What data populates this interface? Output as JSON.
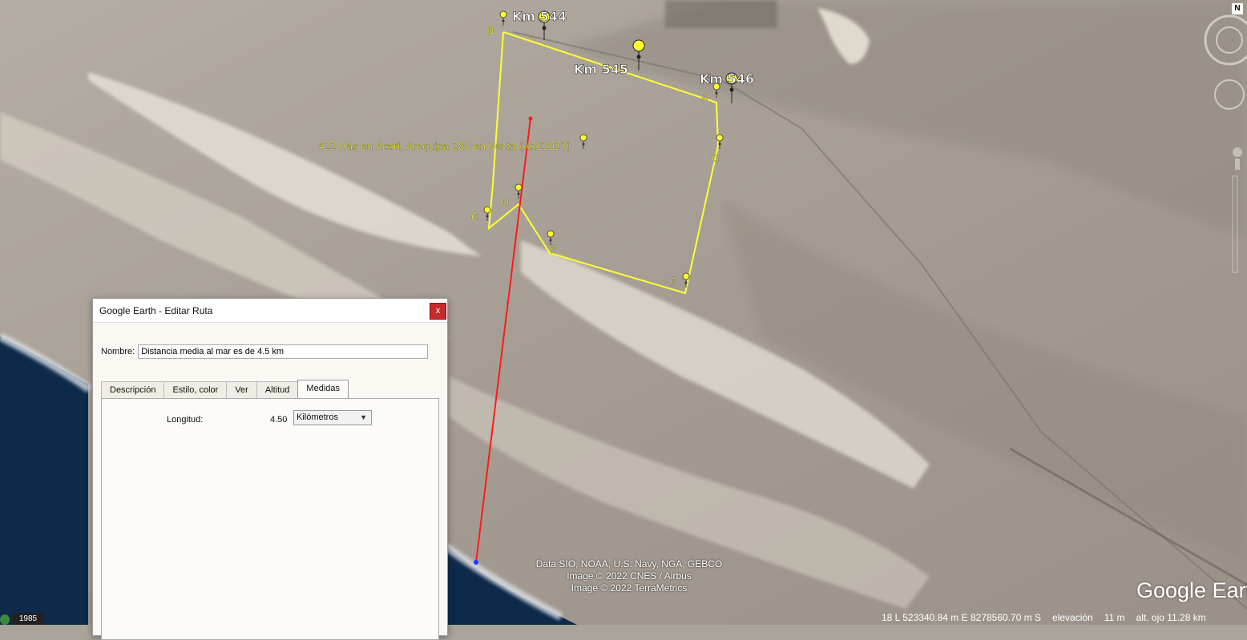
{
  "map": {
    "placemarks": [
      {
        "id": "km544",
        "label": "Km 544"
      },
      {
        "id": "km545",
        "label": "Km 545"
      },
      {
        "id": "km546",
        "label": "Km 546"
      }
    ],
    "parcel_label": "422 Has en Acari, Arequipa 280 en Venta (ARE1027)",
    "vertices": [
      "A",
      "B",
      "C",
      "D",
      "E",
      "F",
      "G"
    ],
    "colors": {
      "polygon": "#ffff33",
      "measure_line": "#ff1a1a",
      "sea": "#0e2a4a"
    },
    "attribution": [
      "Data SIO, NOAA, U.S. Navy, NGA, GEBCO",
      "Image © 2022 CNES / Airbus",
      "Image © 2022 TerraMetrics"
    ],
    "logo": "Google Earth",
    "north": "N",
    "year": "1985",
    "status": {
      "coords": "18 L 523340.84 m E 8278560.70 m S",
      "elev_label": "elevación",
      "elev_value": "11 m",
      "eye": "alt. ojo 11.28 km"
    }
  },
  "dialog": {
    "title": "Google Earth - Editar Ruta",
    "close": "x",
    "name_label": "Nombre:",
    "name_value": "Distancia media al mar es de 4.5 km",
    "tabs": [
      "Descripción",
      "Estilo, color",
      "Ver",
      "Altitud",
      "Medidas"
    ],
    "active_tab": "Medidas",
    "length_label": "Longitud:",
    "length_value": "4.50",
    "units": "Kilómetros"
  }
}
